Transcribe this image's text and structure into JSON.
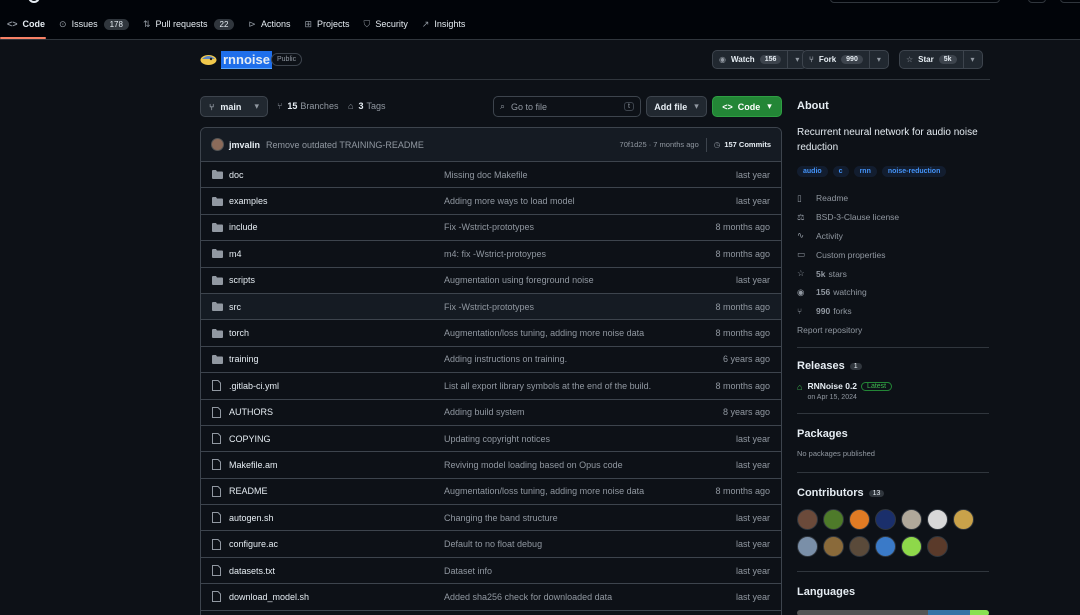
{
  "nav": {
    "tabs": [
      {
        "label": "Code",
        "count": ""
      },
      {
        "label": "Issues",
        "count": "178"
      },
      {
        "label": "Pull requests",
        "count": "22"
      },
      {
        "label": "Actions",
        "count": ""
      },
      {
        "label": "Projects",
        "count": ""
      },
      {
        "label": "Security",
        "count": ""
      },
      {
        "label": "Insights",
        "count": ""
      }
    ]
  },
  "repo": {
    "name": "rnnoise",
    "visibility": "Public",
    "watch_label": "Watch",
    "watch_count": "156",
    "fork_label": "Fork",
    "fork_count": "990",
    "star_label": "Star",
    "star_count": "5k"
  },
  "toolbar": {
    "branch": "main",
    "branches_count": "15",
    "branches_label": "Branches",
    "tags_count": "3",
    "tags_label": "Tags",
    "goto_placeholder": "Go to file",
    "goto_kbd": "t",
    "add_file_label": "Add file",
    "code_label": "Code"
  },
  "commit": {
    "author": "jmvalin",
    "message": "Remove outdated TRAINING-README",
    "hash_time": "70f1d25 · 7 months ago",
    "count_label": "157 Commits"
  },
  "files": [
    {
      "name": "doc",
      "type": "dir",
      "msg": "Missing doc Makefile",
      "date": "last year"
    },
    {
      "name": "examples",
      "type": "dir",
      "msg": "Adding more ways to load model",
      "date": "last year"
    },
    {
      "name": "include",
      "type": "dir",
      "msg": "Fix -Wstrict-prototypes",
      "date": "8 months ago"
    },
    {
      "name": "m4",
      "type": "dir",
      "msg": "m4: fix -Wstrict-protoypes",
      "date": "8 months ago"
    },
    {
      "name": "scripts",
      "type": "dir",
      "msg": "Augmentation using foreground noise",
      "date": "last year"
    },
    {
      "name": "src",
      "type": "dir",
      "msg": "Fix -Wstrict-prototypes",
      "date": "8 months ago"
    },
    {
      "name": "torch",
      "type": "dir",
      "msg": "Augmentation/loss tuning, adding more noise data",
      "date": "8 months ago"
    },
    {
      "name": "training",
      "type": "dir",
      "msg": "Adding instructions on training.",
      "date": "6 years ago"
    },
    {
      "name": ".gitlab-ci.yml",
      "type": "file",
      "msg": "List all export library symbols at the end of the build.",
      "date": "8 months ago"
    },
    {
      "name": "AUTHORS",
      "type": "file",
      "msg": "Adding build system",
      "date": "8 years ago"
    },
    {
      "name": "COPYING",
      "type": "file",
      "msg": "Updating copyright notices",
      "date": "last year"
    },
    {
      "name": "Makefile.am",
      "type": "file",
      "msg": "Reviving model loading based on Opus code",
      "date": "last year"
    },
    {
      "name": "README",
      "type": "file",
      "msg": "Augmentation/loss tuning, adding more noise data",
      "date": "8 months ago"
    },
    {
      "name": "autogen.sh",
      "type": "file",
      "msg": "Changing the band structure",
      "date": "last year"
    },
    {
      "name": "configure.ac",
      "type": "file",
      "msg": "Default to no float debug",
      "date": "last year"
    },
    {
      "name": "datasets.txt",
      "type": "file",
      "msg": "Dataset info",
      "date": "last year"
    },
    {
      "name": "download_model.sh",
      "type": "file",
      "msg": "Added sha256 check for downloaded data",
      "date": "last year"
    }
  ],
  "about": {
    "title": "About",
    "description": "Recurrent neural network for audio noise reduction",
    "topics": [
      "audio",
      "c",
      "rnn",
      "noise-reduction"
    ],
    "links": [
      {
        "icon": "book-icon",
        "bold": "",
        "label": "Readme"
      },
      {
        "icon": "law-icon",
        "bold": "",
        "label": "BSD-3-Clause license"
      },
      {
        "icon": "pulse-icon",
        "bold": "",
        "label": "Activity"
      },
      {
        "icon": "note-icon",
        "bold": "",
        "label": "Custom properties"
      },
      {
        "icon": "star-icon",
        "bold": "5k",
        "label": "stars"
      },
      {
        "icon": "eye-icon",
        "bold": "156",
        "label": "watching"
      },
      {
        "icon": "fork-icon",
        "bold": "990",
        "label": "forks"
      },
      {
        "icon": "",
        "bold": "",
        "label": "Report repository"
      }
    ]
  },
  "releases": {
    "title": "Releases",
    "count": "1",
    "name": "RNNoise 0.2",
    "badge": "Latest",
    "date": "on Apr 15, 2024"
  },
  "packages": {
    "title": "Packages",
    "empty": "No packages published"
  },
  "contributors": {
    "title": "Contributors",
    "count": "13",
    "avatar_colors": [
      "#6b4a3a",
      "#4e7a2a",
      "#e07b24",
      "#1a2f6b",
      "#b0a89a",
      "#d8d8d8",
      "#c9a24a",
      "#7a8fa8",
      "#8a6a3a",
      "#5a4a3a",
      "#3a7ac8",
      "#8ed84a",
      "#5a3a2a"
    ]
  },
  "languages": {
    "title": "Languages",
    "colors": [
      "#555555",
      "#3572A5",
      "#89e051"
    ],
    "shares": [
      0.68,
      0.22,
      0.1
    ]
  }
}
